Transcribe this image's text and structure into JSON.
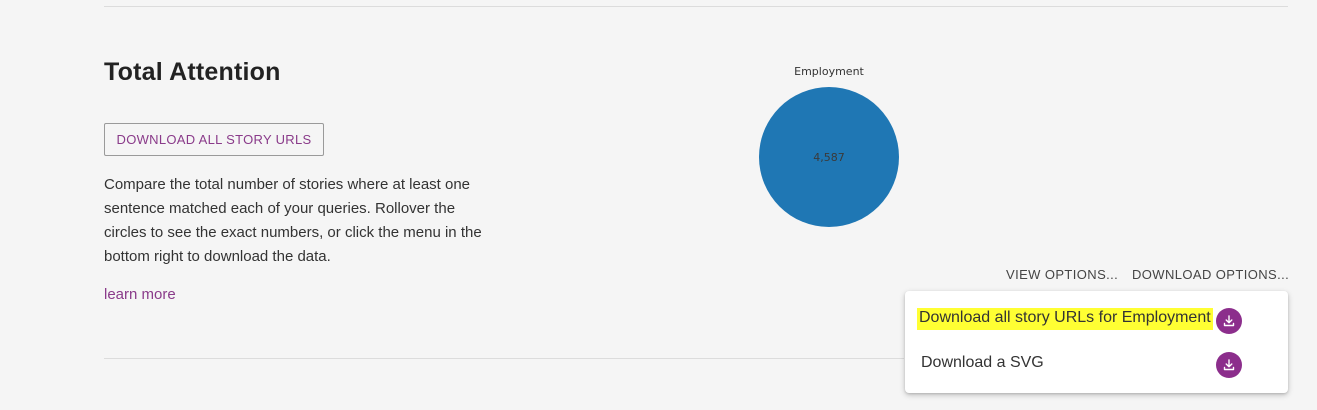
{
  "section": {
    "title": "Total Attention",
    "download_button_label": "DOWNLOAD ALL STORY URLS",
    "description": "Compare the total number of stories where at least one sentence matched each of your queries. Rollover the circles to see the exact numbers, or click the menu in the bottom right to download the data.",
    "learn_more_label": "learn more"
  },
  "options": {
    "view_label": "VIEW OPTIONS...",
    "download_label": "DOWNLOAD OPTIONS..."
  },
  "download_menu": {
    "items": [
      {
        "label": "Download all story URLs for Employment",
        "icon": "download-icon",
        "highlighted": true
      },
      {
        "label": "Download a SVG",
        "icon": "download-icon",
        "highlighted": false
      }
    ]
  },
  "chart_data": {
    "type": "bubble",
    "series": [
      {
        "name": "Employment",
        "value": 4587,
        "value_label": "4,587",
        "color": "#1f77b4"
      }
    ]
  },
  "colors": {
    "accent": "#8a3b8a",
    "icon_bg": "#8c2e8c",
    "highlight": "#ffff33",
    "bubble": "#1f77b4"
  }
}
